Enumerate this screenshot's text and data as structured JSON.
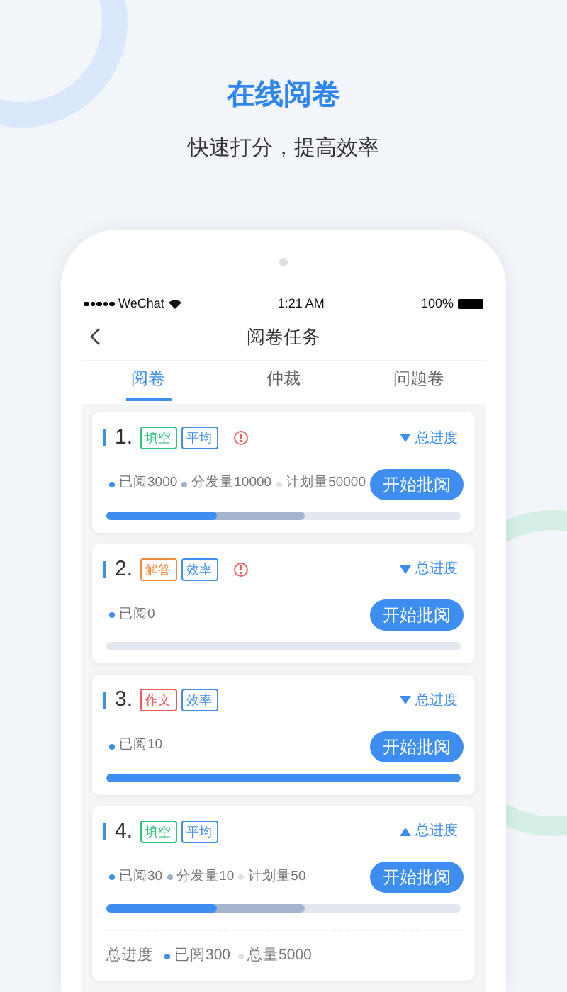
{
  "headline": "在线阅卷",
  "subtitle": "快速打分，提高效率",
  "status_bar": {
    "carrier": "WeChat",
    "time": "1:21 AM",
    "battery": "100%"
  },
  "nav": {
    "title": "阅卷任务"
  },
  "tabs": [
    {
      "label": "阅卷",
      "selected": true
    },
    {
      "label": "仲裁",
      "selected": false
    },
    {
      "label": "问题卷",
      "selected": false
    }
  ],
  "tasks": [
    {
      "number": "1.",
      "tags": [
        {
          "label": "填空",
          "color": "#2ec27e"
        },
        {
          "label": "平均",
          "color": "#3d8ef0"
        }
      ],
      "warning": true,
      "progress_label": "总进度",
      "expanded": false,
      "stats": [
        {
          "text": "已阅3000",
          "color": "#3d8ef0"
        },
        {
          "text": "分发量10000",
          "color": "#9fb1c9"
        },
        {
          "text": "计划量50000",
          "color": "#dde3ea"
        }
      ],
      "button": "开始批阅",
      "progress": [
        {
          "kind": "distributed",
          "level": 0.56
        },
        {
          "kind": "read",
          "level": 0.31
        }
      ]
    },
    {
      "number": "2.",
      "tags": [
        {
          "label": "解答",
          "color": "#f5893d"
        },
        {
          "label": "效率",
          "color": "#3d8ef0"
        }
      ],
      "warning": true,
      "progress_label": "总进度",
      "expanded": false,
      "stats": [
        {
          "text": "已阅0",
          "color": "#3d8ef0"
        }
      ],
      "button": "开始批阅",
      "progress": [
        {
          "kind": "read",
          "level": 0
        }
      ]
    },
    {
      "number": "3.",
      "tags": [
        {
          "label": "作文",
          "color": "#f0585a"
        },
        {
          "label": "效率",
          "color": "#3d8ef0"
        }
      ],
      "warning": false,
      "progress_label": "总进度",
      "expanded": false,
      "stats": [
        {
          "text": "已阅10",
          "color": "#3d8ef0"
        }
      ],
      "button": "开始批阅",
      "progress": [
        {
          "kind": "read",
          "level": 1
        }
      ]
    },
    {
      "number": "4.",
      "tags": [
        {
          "label": "填空",
          "color": "#2ec27e"
        },
        {
          "label": "平均",
          "color": "#3d8ef0"
        }
      ],
      "warning": false,
      "progress_label": "总进度",
      "expanded": true,
      "stats": [
        {
          "text": "已阅30",
          "color": "#3d8ef0"
        },
        {
          "text": "分发量10",
          "color": "#9fb1c9"
        },
        {
          "text": "计划量50",
          "color": "#dde3ea"
        }
      ],
      "button": "开始批阅",
      "progress": [
        {
          "kind": "distributed",
          "level": 0.56
        },
        {
          "kind": "read",
          "level": 0.31
        }
      ],
      "total": {
        "label": "总进度",
        "stats": [
          {
            "text": "已阅300",
            "color": "#3d8ef0"
          },
          {
            "text": "总量5000",
            "color": "#dde3ea"
          }
        ]
      }
    }
  ]
}
